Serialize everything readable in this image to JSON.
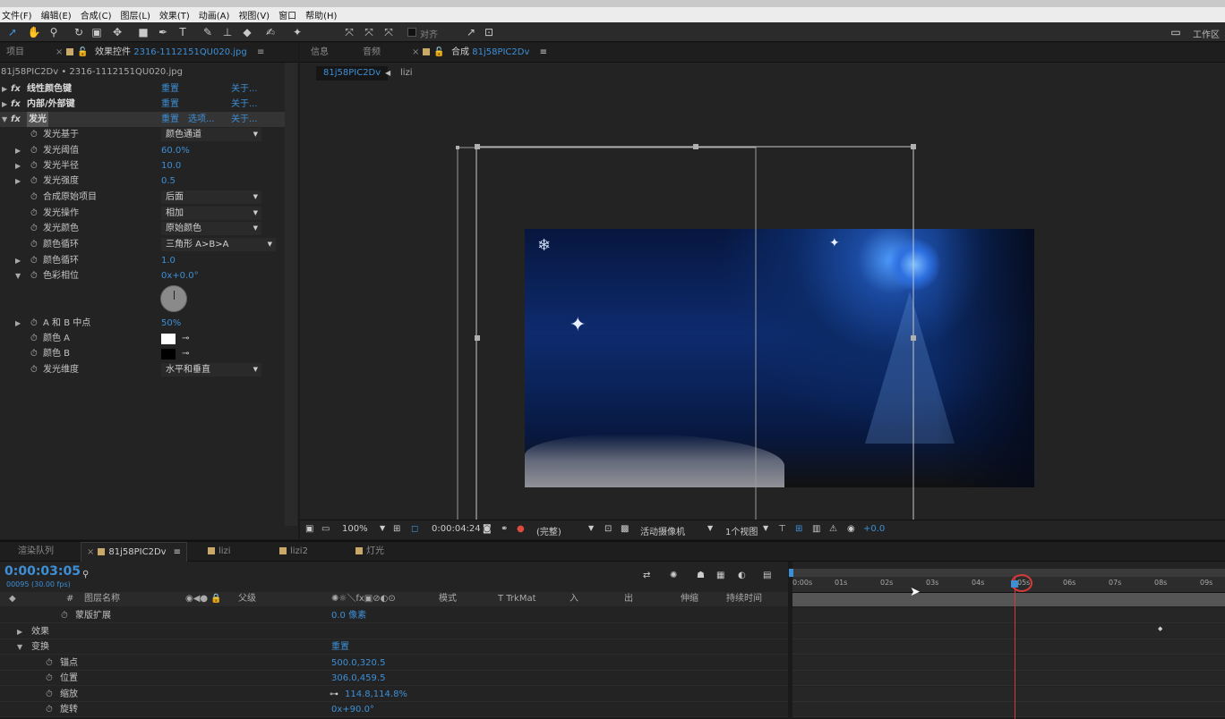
{
  "menubar": [
    "文件(F)",
    "编辑(E)",
    "合成(C)",
    "图层(L)",
    "效果(T)",
    "动画(A)",
    "视图(V)",
    "窗口",
    "帮助(H)"
  ],
  "toolbar": {
    "align_label": "对齐",
    "workspace_label": "工作区"
  },
  "left_panel": {
    "tab_project": "项目",
    "tab_effects": "效果控件",
    "tab_effects_file": "2316-1112151QU020.jpg",
    "breadcrumb": "81j58PIC2Dv • 2316-1112151QU020.jpg",
    "effects": [
      {
        "name": "线性颜色键",
        "reset": "重置",
        "about": "关于..."
      },
      {
        "name": "内部/外部键",
        "reset": "重置",
        "about": "关于..."
      },
      {
        "name": "发光",
        "reset": "重置",
        "options": "选项...",
        "about": "关于..."
      }
    ],
    "glow": {
      "based_on": {
        "label": "发光基于",
        "value": "颜色通道"
      },
      "threshold": {
        "label": "发光阈值",
        "value": "60.0%"
      },
      "radius": {
        "label": "发光半径",
        "value": "10.0"
      },
      "intensity": {
        "label": "发光强度",
        "value": "0.5"
      },
      "composite": {
        "label": "合成原始项目",
        "value": "后面"
      },
      "operation": {
        "label": "发光操作",
        "value": "相加"
      },
      "colors": {
        "label": "发光颜色",
        "value": "原始颜色"
      },
      "color_loop": {
        "label": "颜色循环",
        "value": "三角形 A>B>A"
      },
      "color_loops": {
        "label": "颜色循环",
        "value": "1.0"
      },
      "phase": {
        "label": "色彩相位",
        "value": "0x+0.0°"
      },
      "ab_mid": {
        "label": "A 和 B 中点",
        "value": "50%"
      },
      "color_a": {
        "label": "颜色 A"
      },
      "color_b": {
        "label": "颜色 B"
      },
      "dimensions": {
        "label": "发光维度",
        "value": "水平和垂直"
      }
    }
  },
  "viewer": {
    "tab_info": "信息",
    "tab_audio": "音频",
    "tab_comp": "合成",
    "tab_comp_name": "81j58PIC2Dv",
    "crumb_active": "81j58PIC2Dv",
    "crumb_next": "lizi",
    "zoom": "100%",
    "timecode": "0:00:04:24",
    "resolution": "(完整)",
    "camera": "活动摄像机",
    "views": "1个视图",
    "exposure": "+0.0"
  },
  "timeline": {
    "tab_render": "渲染队列",
    "tabs": [
      "81j58PIC2Dv",
      "lizi",
      "lizi2",
      "灯光"
    ],
    "current_time": "0:00:03:05",
    "fps_info": "00095 (30.00 fps)",
    "headers": {
      "layer_name": "图层名称",
      "parent": "父级",
      "mode": "模式",
      "trkmat": "TrkMat",
      "in": "入",
      "out": "出",
      "stretch": "伸缩",
      "duration": "持续时间"
    },
    "rows": [
      {
        "label": "蒙版扩展",
        "value": "0.0 像素"
      },
      {
        "label": "效果",
        "value": ""
      },
      {
        "label": "变换",
        "value": "重置"
      },
      {
        "label": "锚点",
        "value": "500.0,320.5"
      },
      {
        "label": "位置",
        "value": "306.0,459.5"
      },
      {
        "label": "缩放",
        "value": "114.8,114.8%"
      },
      {
        "label": "旋转",
        "value": "0x+90.0°"
      }
    ],
    "ruler": [
      "0:00s",
      "01s",
      "02s",
      "03s",
      "04s",
      "05s",
      "06s",
      "07s",
      "08s",
      "09s"
    ]
  },
  "colors": {
    "accent": "#3d8fd6",
    "playhead": "#d43a3a"
  }
}
